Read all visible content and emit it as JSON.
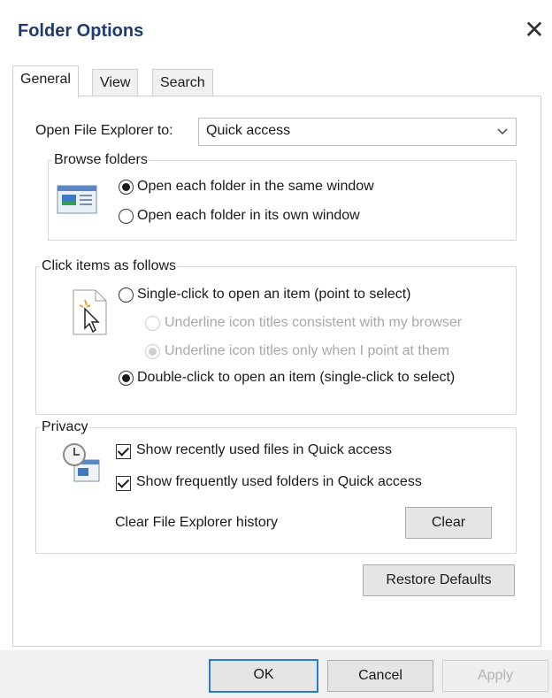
{
  "window": {
    "title": "Folder Options",
    "close_glyph": "✕"
  },
  "tabs": [
    {
      "label": "General",
      "active": true
    },
    {
      "label": "View"
    },
    {
      "label": "Search"
    }
  ],
  "general": {
    "open_to_label": "Open File Explorer to:",
    "open_to_value": "Quick access",
    "browse": {
      "legend": "Browse folders",
      "option_same": "Open each folder in the same window",
      "option_own": "Open each folder in its own window"
    },
    "click": {
      "legend": "Click items as follows",
      "option_single": "Single-click to open an item (point to select)",
      "sub_browser": "Underline icon titles consistent with my browser",
      "sub_point": "Underline icon titles only when I point at them",
      "option_double": "Double-click to open an item (single-click to select)"
    },
    "privacy": {
      "legend": "Privacy",
      "recent_files": "Show recently used files in Quick access",
      "frequent_folders": "Show frequently used folders in Quick access",
      "clear_label": "Clear File Explorer history",
      "clear_button": "Clear"
    },
    "restore_button": "Restore Defaults"
  },
  "footer": {
    "ok": "OK",
    "cancel": "Cancel",
    "apply": "Apply"
  },
  "icons": {
    "chevron": "chevron-down-icon",
    "browse": "window-layout-icon",
    "click": "pointer-cursor-icon",
    "privacy": "clock-document-icon"
  },
  "colors": {
    "title": "#1f3b6e",
    "focus_border": "#2a7bd6"
  }
}
